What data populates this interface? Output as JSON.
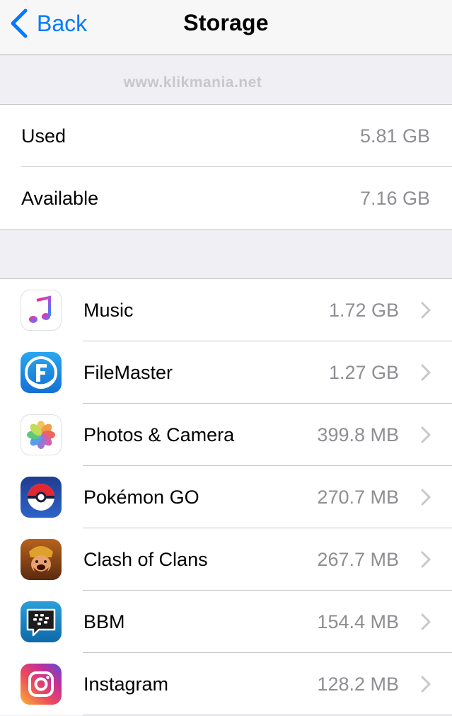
{
  "nav": {
    "back_label": "Back",
    "title": "Storage"
  },
  "watermark": "www.klikmania.net",
  "storage": {
    "used": {
      "label": "Used",
      "value": "5.81 GB"
    },
    "available": {
      "label": "Available",
      "value": "7.16 GB"
    }
  },
  "apps": [
    {
      "name": "Music",
      "size": "1.72 GB",
      "icon": "music-icon"
    },
    {
      "name": "FileMaster",
      "size": "1.27 GB",
      "icon": "filemaster-icon"
    },
    {
      "name": "Photos & Camera",
      "size": "399.8 MB",
      "icon": "photos-icon"
    },
    {
      "name": "Pokémon GO",
      "size": "270.7 MB",
      "icon": "pokeball-icon"
    },
    {
      "name": "Clash of Clans",
      "size": "267.7 MB",
      "icon": "clash-of-clans-icon"
    },
    {
      "name": "BBM",
      "size": "154.4 MB",
      "icon": "bbm-icon"
    },
    {
      "name": "Instagram",
      "size": "128.2 MB",
      "icon": "instagram-icon"
    }
  ],
  "colors": {
    "accent": "#007aff",
    "background": "#efeff4",
    "secondary_text": "#8e8e93",
    "separator": "#c8c7cc"
  }
}
